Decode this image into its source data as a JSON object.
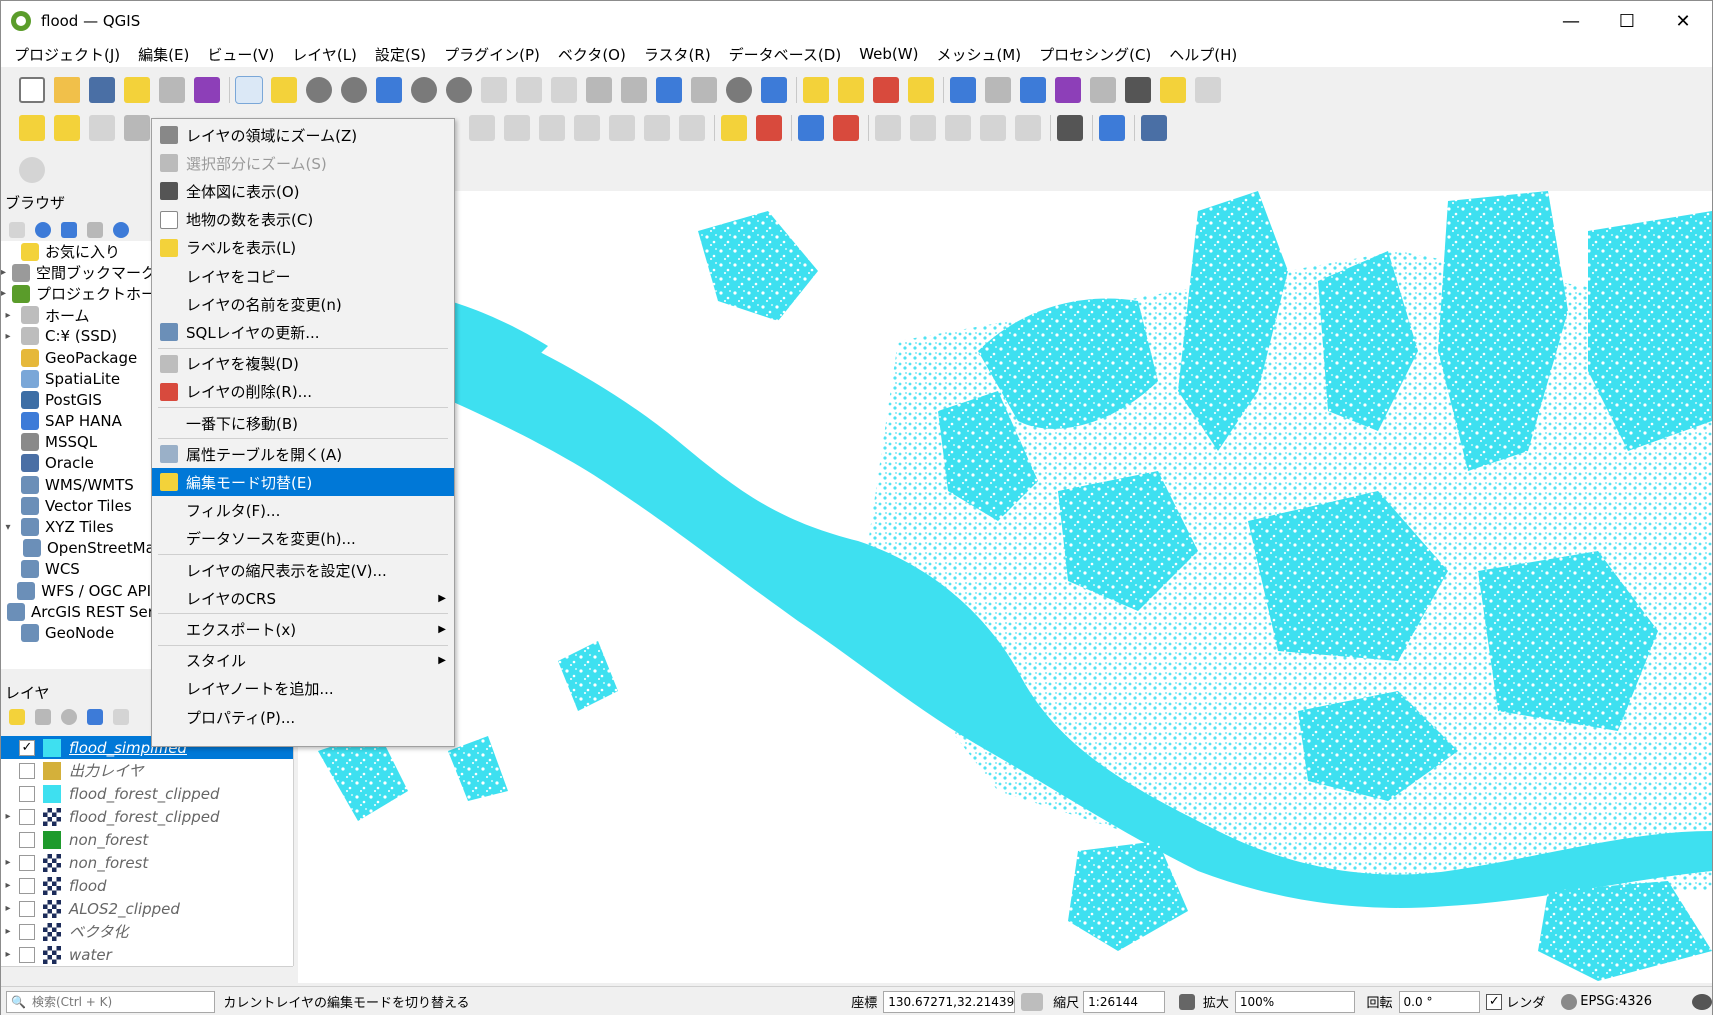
{
  "window": {
    "title": "flood — QGIS",
    "minimize": "—",
    "maximize": "☐",
    "close": "✕"
  },
  "menubar": [
    "プロジェクト(J)",
    "編集(E)",
    "ビュー(V)",
    "レイヤ(L)",
    "設定(S)",
    "プラグイン(P)",
    "ベクタ(O)",
    "ラスタ(R)",
    "データベース(D)",
    "Web(W)",
    "メッシュ(M)",
    "プロセシング(C)",
    "ヘルプ(H)"
  ],
  "browser": {
    "title": "ブラウザ",
    "items": [
      {
        "label": "お気に入り",
        "icon": "star-icon",
        "arrow": "",
        "color": "#f3d23a"
      },
      {
        "label": "空間ブックマーク",
        "icon": "bookmark-icon",
        "arrow": "▸",
        "color": "#9a9a9a"
      },
      {
        "label": "プロジェクトホーム",
        "icon": "project-home-icon",
        "arrow": "▸",
        "color": "#5a9c2a"
      },
      {
        "label": "ホーム",
        "icon": "home-icon",
        "arrow": "▸",
        "color": "#bdbdbd"
      },
      {
        "label": "C:¥ (SSD)",
        "icon": "drive-icon",
        "arrow": "▸",
        "color": "#bdbdbd"
      },
      {
        "label": "GeoPackage",
        "icon": "geopackage-icon",
        "arrow": "",
        "color": "#e6b83a"
      },
      {
        "label": "SpatiaLite",
        "icon": "spatialite-icon",
        "arrow": "",
        "color": "#7aa7d8"
      },
      {
        "label": "PostGIS",
        "icon": "postgis-icon",
        "arrow": "",
        "color": "#3d6ea5"
      },
      {
        "label": "SAP HANA",
        "icon": "sap-hana-icon",
        "arrow": "",
        "color": "#3d7bd8"
      },
      {
        "label": "MSSQL",
        "icon": "mssql-icon",
        "arrow": "",
        "color": "#8a8a8a"
      },
      {
        "label": "Oracle",
        "icon": "oracle-icon",
        "arrow": "",
        "color": "#4a6fa5"
      },
      {
        "label": "WMS/WMTS",
        "icon": "wms-icon",
        "arrow": "",
        "color": "#6b8fb8"
      },
      {
        "label": "Vector Tiles",
        "icon": "vector-tiles-icon",
        "arrow": "",
        "color": "#6b8fb8"
      },
      {
        "label": "XYZ Tiles",
        "icon": "xyz-tiles-icon",
        "arrow": "▾",
        "color": "#6b8fb8"
      },
      {
        "label": "OpenStreetMap",
        "icon": "openstreetmap-icon",
        "arrow": "",
        "color": "#6b8fb8",
        "indent": true
      },
      {
        "label": "WCS",
        "icon": "wcs-icon",
        "arrow": "",
        "color": "#6b8fb8"
      },
      {
        "label": "WFS / OGC API",
        "icon": "wfs-icon",
        "arrow": "",
        "color": "#6b8fb8"
      },
      {
        "label": "ArcGIS REST Servers",
        "icon": "arcgis-icon",
        "arrow": "",
        "color": "#6b8fb8"
      },
      {
        "label": "GeoNode",
        "icon": "geonode-icon",
        "arrow": "",
        "color": "#6b8fb8"
      }
    ]
  },
  "layers": {
    "title": "レイヤ",
    "items": [
      {
        "label": "flood_simplified",
        "checked": true,
        "selected": true,
        "arrow": "",
        "swatch": "#3ee0f0",
        "raster": false
      },
      {
        "label": "出力レイヤ",
        "checked": false,
        "selected": false,
        "arrow": "",
        "swatch": "#d4b03a",
        "raster": false
      },
      {
        "label": "flood_forest_clipped",
        "checked": false,
        "selected": false,
        "arrow": "",
        "swatch": "#3ee0f0",
        "raster": false
      },
      {
        "label": "flood_forest_clipped",
        "checked": false,
        "selected": false,
        "arrow": "▸",
        "swatch": "",
        "raster": true
      },
      {
        "label": "non_forest",
        "checked": false,
        "selected": false,
        "arrow": "",
        "swatch": "#1e9a2c",
        "raster": false
      },
      {
        "label": "non_forest",
        "checked": false,
        "selected": false,
        "arrow": "▸",
        "swatch": "",
        "raster": true
      },
      {
        "label": "flood",
        "checked": false,
        "selected": false,
        "arrow": "▸",
        "swatch": "",
        "raster": true
      },
      {
        "label": "ALOS2_clipped",
        "checked": false,
        "selected": false,
        "arrow": "▸",
        "swatch": "",
        "raster": true
      },
      {
        "label": "ベクタ化",
        "checked": false,
        "selected": false,
        "arrow": "▸",
        "swatch": "",
        "raster": true
      },
      {
        "label": "water",
        "checked": false,
        "selected": false,
        "arrow": "▸",
        "swatch": "",
        "raster": true
      }
    ]
  },
  "context_menu": {
    "items": [
      {
        "label": "レイヤの領域にズーム(Z)",
        "icon": "zoom-layer-icon",
        "disabled": false,
        "highlight": false,
        "submenu": false,
        "color": "#888"
      },
      {
        "label": "選択部分にズーム(S)",
        "icon": "zoom-selection-icon",
        "disabled": true,
        "highlight": false,
        "submenu": false,
        "color": "#bbb"
      },
      {
        "label": "全体図に表示(O)",
        "icon": "overview-icon",
        "disabled": false,
        "highlight": false,
        "submenu": false,
        "color": "#555"
      },
      {
        "label": "地物の数を表示(C)",
        "icon": "checkbox-icon",
        "disabled": false,
        "highlight": false,
        "submenu": false,
        "color": "#fff"
      },
      {
        "label": "ラベルを表示(L)",
        "icon": "label-icon",
        "disabled": false,
        "highlight": false,
        "submenu": false,
        "color": "#f3d23a"
      },
      {
        "label": "レイヤをコピー",
        "icon": "",
        "disabled": false,
        "highlight": false,
        "submenu": false,
        "color": ""
      },
      {
        "label": "レイヤの名前を変更(n)",
        "icon": "",
        "disabled": false,
        "highlight": false,
        "submenu": false,
        "color": ""
      },
      {
        "label": "SQLレイヤの更新...",
        "icon": "database-icon",
        "disabled": false,
        "highlight": false,
        "submenu": false,
        "color": "#6b8fb8"
      },
      {
        "label": "レイヤを複製(D)",
        "icon": "duplicate-icon",
        "disabled": false,
        "highlight": false,
        "submenu": false,
        "color": "#bdbdbd",
        "sep_before": true
      },
      {
        "label": "レイヤの削除(R)...",
        "icon": "remove-layer-icon",
        "disabled": false,
        "highlight": false,
        "submenu": false,
        "color": "#d84a3d"
      },
      {
        "label": "一番下に移動(B)",
        "icon": "",
        "disabled": false,
        "highlight": false,
        "submenu": false,
        "color": "",
        "sep_before": true
      },
      {
        "label": "属性テーブルを開く(A)",
        "icon": "attribute-table-icon",
        "disabled": false,
        "highlight": false,
        "submenu": false,
        "color": "#9ab0c8",
        "sep_before": true
      },
      {
        "label": "編集モード切替(E)",
        "icon": "pencil-icon",
        "disabled": false,
        "highlight": true,
        "submenu": false,
        "color": "#f3d23a"
      },
      {
        "label": "フィルタ(F)...",
        "icon": "",
        "disabled": false,
        "highlight": false,
        "submenu": false,
        "color": ""
      },
      {
        "label": "データソースを変更(h)...",
        "icon": "",
        "disabled": false,
        "highlight": false,
        "submenu": false,
        "color": ""
      },
      {
        "label": "レイヤの縮尺表示を設定(V)...",
        "icon": "",
        "disabled": false,
        "highlight": false,
        "submenu": false,
        "color": "",
        "sep_before": true
      },
      {
        "label": "レイヤのCRS",
        "icon": "",
        "disabled": false,
        "highlight": false,
        "submenu": true,
        "color": ""
      },
      {
        "label": "エクスポート(x)",
        "icon": "",
        "disabled": false,
        "highlight": false,
        "submenu": true,
        "color": "",
        "sep_before": true
      },
      {
        "label": "スタイル",
        "icon": "",
        "disabled": false,
        "highlight": false,
        "submenu": true,
        "color": "",
        "sep_before": true
      },
      {
        "label": "レイヤノートを追加...",
        "icon": "",
        "disabled": false,
        "highlight": false,
        "submenu": false,
        "color": ""
      },
      {
        "label": "プロパティ(P)...",
        "icon": "",
        "disabled": false,
        "highlight": false,
        "submenu": false,
        "color": ""
      }
    ]
  },
  "statusbar": {
    "search_placeholder": "検索(Ctrl + K)",
    "message": "カレントレイヤの編集モードを切り替える",
    "coord_label": "座標",
    "coord_value": "130.67271,32.21439",
    "scale_label": "縮尺",
    "scale_value": "1:26144",
    "magnifier_label": "拡大",
    "magnifier_value": "100%",
    "rotation_label": "回転",
    "rotation_value": "0.0 °",
    "render_label": "レンダ",
    "crs_value": "EPSG:4326"
  },
  "colors": {
    "flood": "#3ee0f0",
    "highlight": "#0078d7"
  }
}
